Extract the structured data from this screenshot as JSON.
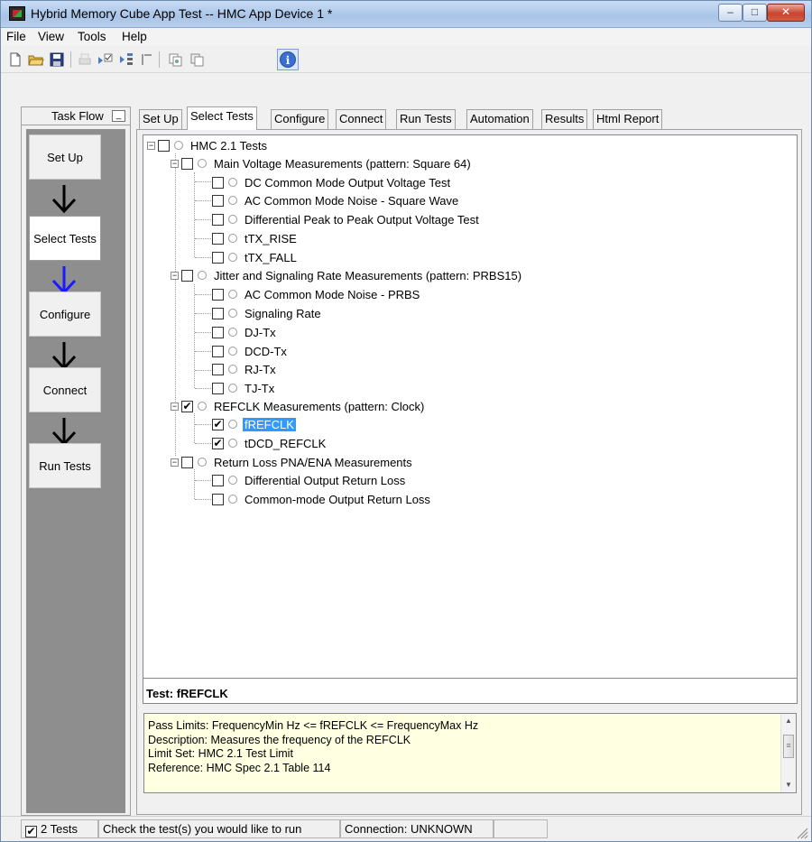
{
  "window": {
    "title": "Hybrid Memory Cube App Test -- HMC App Device 1 *",
    "controls": {
      "minimize": "–",
      "maximize": "□",
      "close": "✕"
    }
  },
  "menu": [
    "File",
    "View",
    "Tools",
    "Help"
  ],
  "toolbar": {
    "icons": [
      "new-file-icon",
      "open-folder-icon",
      "save-icon",
      "print-icon",
      "run-checked-icon",
      "run-selected-icon",
      "stop-icon",
      "copy-icon",
      "paste-icon",
      "info-icon"
    ],
    "info_glyph": "i"
  },
  "taskflow": {
    "title": "Task Flow",
    "minimize_glyph": "_",
    "steps": [
      "Set Up",
      "Select Tests",
      "Configure",
      "Connect",
      "Run Tests"
    ],
    "active_step": "Select Tests"
  },
  "tabs": [
    "Set Up",
    "Select Tests",
    "Configure",
    "Connect",
    "Run Tests",
    "Automation",
    "Results",
    "Html Report"
  ],
  "active_tab": "Select Tests",
  "tree": {
    "root": {
      "label": "HMC 2.1 Tests",
      "checked": false
    },
    "groups": [
      {
        "label": "Main Voltage Measurements (pattern: Square 64)",
        "checked": false,
        "items": [
          {
            "label": "DC Common Mode Output Voltage Test",
            "checked": false
          },
          {
            "label": "AC Common Mode Noise - Square Wave",
            "checked": false
          },
          {
            "label": "Differential Peak to Peak Output Voltage Test",
            "checked": false
          },
          {
            "label": "tTX_RISE",
            "checked": false
          },
          {
            "label": "tTX_FALL",
            "checked": false
          }
        ]
      },
      {
        "label": "Jitter and Signaling Rate Measurements (pattern: PRBS15)",
        "checked": false,
        "items": [
          {
            "label": "AC Common Mode Noise - PRBS",
            "checked": false
          },
          {
            "label": "Signaling Rate",
            "checked": false
          },
          {
            "label": "DJ-Tx",
            "checked": false
          },
          {
            "label": "DCD-Tx",
            "checked": false
          },
          {
            "label": "RJ-Tx",
            "checked": false
          },
          {
            "label": "TJ-Tx",
            "checked": false
          }
        ]
      },
      {
        "label": "REFCLK Measurements (pattern: Clock)",
        "checked": true,
        "items": [
          {
            "label": "fREFCLK",
            "checked": true,
            "selected": true
          },
          {
            "label": "tDCD_REFCLK",
            "checked": true
          }
        ]
      },
      {
        "label": "Return Loss PNA/ENA Measurements",
        "checked": false,
        "items": [
          {
            "label": "Differential Output Return Loss",
            "checked": false
          },
          {
            "label": "Common-mode Output Return Loss",
            "checked": false
          }
        ]
      }
    ]
  },
  "detail": {
    "header": "Test: fREFCLK",
    "lines": [
      "Pass Limits: FrequencyMin Hz <= fREFCLK <= FrequencyMax Hz",
      "Description: Measures the frequency of the REFCLK",
      "Limit Set: HMC 2.1 Test Limit",
      "Reference: HMC Spec 2.1 Table 114"
    ]
  },
  "status": {
    "tests_count": "2 Tests",
    "hint": "Check the test(s) you would like to run",
    "connection": "Connection: UNKNOWN"
  },
  "glyphs": {
    "check": "✔",
    "collapse": "−"
  },
  "colors": {
    "selection": "#3399ff",
    "detail_bg": "#ffffe1",
    "active_arrow": "#1a1aff",
    "flow_panel": "#8e8e8e"
  }
}
